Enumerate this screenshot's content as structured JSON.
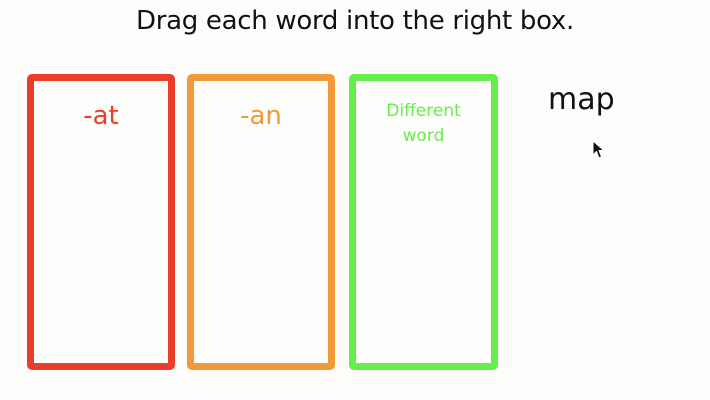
{
  "instruction": "Drag each word into the right box.",
  "boxes": [
    {
      "label": "-at",
      "color": "#ea3e2c"
    },
    {
      "label": "-an",
      "color": "#f29a3a"
    },
    {
      "label": "Different word",
      "color": "#66ee4b"
    }
  ],
  "draggable_word": "map",
  "icons": {
    "cursor": "mouse-pointer-icon"
  }
}
